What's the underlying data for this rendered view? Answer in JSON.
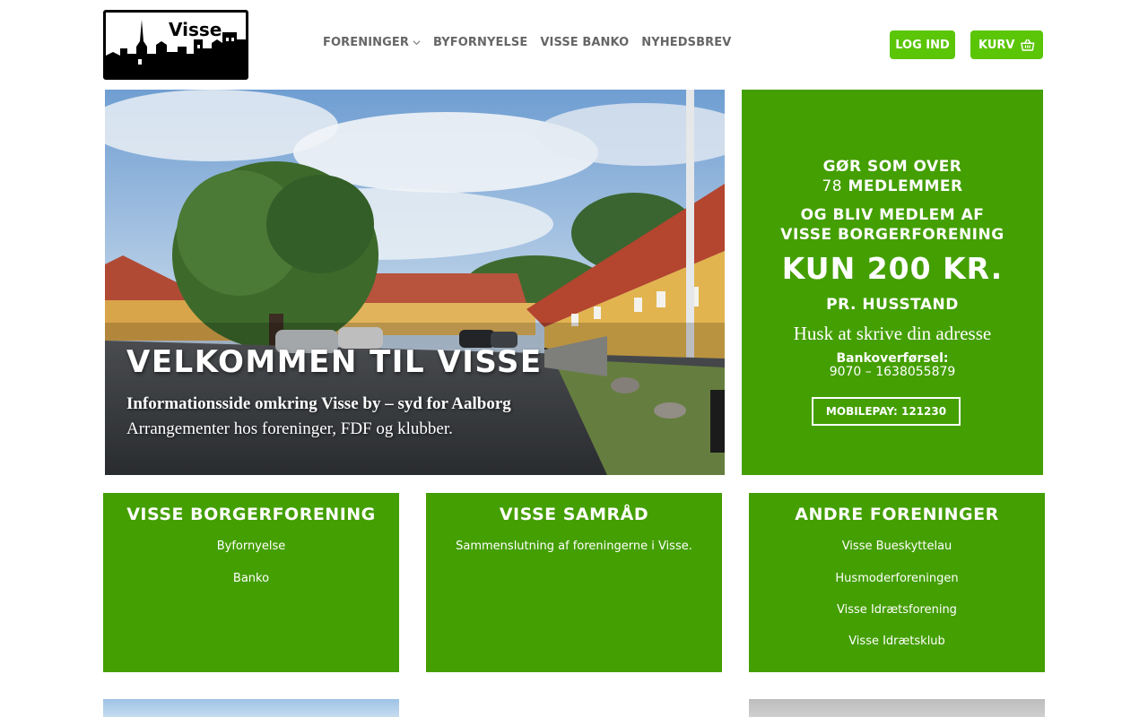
{
  "header": {
    "logo_text": "Visse",
    "nav": [
      {
        "label": "FORENINGER",
        "has_dropdown": true
      },
      {
        "label": "BYFORNYELSE",
        "has_dropdown": false
      },
      {
        "label": "VISSE BANKO",
        "has_dropdown": false
      },
      {
        "label": "NYHEDSBREV",
        "has_dropdown": false
      }
    ],
    "login_label": "LOG IND",
    "cart_label": "KURV",
    "cart_icon": "basket-icon",
    "accent": "#5bc507"
  },
  "hero": {
    "title": "VELKOMMEN TIL VISSE",
    "subtitle": "Informationsside omkring Visse by – syd for Aalborg",
    "subtitle2": "Arrangementer hos foreninger, FDF og klubber."
  },
  "membership": {
    "line1": "GØR SOM OVER",
    "count": "78",
    "line2_suffix": " MEDLEMMER",
    "line3": "OG BLIV MEDLEM AF",
    "line4": "VISSE BORGERFORENING",
    "price": "KUN 200 KR.",
    "per": "PR. HUSSTAND",
    "reminder": "Husk at skrive din adresse",
    "bank_label": "Bankoverførsel:",
    "bank_account": "9070 – 1638055879",
    "mobilepay": "MOBILEPAY: 121230",
    "bg_color": "#449f02"
  },
  "cards": [
    {
      "title": "VISSE BORGERFORENING",
      "links": [
        "Byfornyelse",
        "Banko"
      ]
    },
    {
      "title": "VISSE SAMRÅD",
      "text": "Sammenslutning af foreningerne i Visse."
    },
    {
      "title": "ANDRE FORENINGER",
      "links": [
        "Visse Bueskyttelau",
        "Husmoderforeningen",
        "Visse Idrætsforening",
        "Visse Idrætsklub"
      ]
    }
  ]
}
